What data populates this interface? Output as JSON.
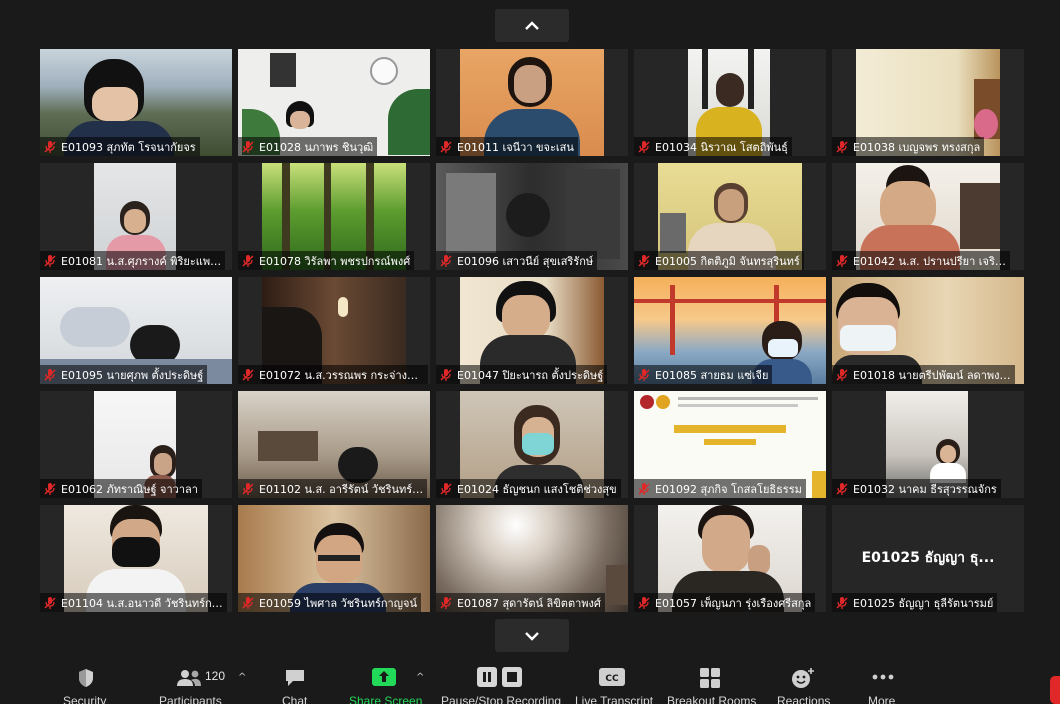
{
  "participants": [
    {
      "name": "E01093 สุภทัต โรจนากัยจร"
    },
    {
      "name": "E01028 นภาพร ชินวุฒิ"
    },
    {
      "name": "E01011 เจนีวา ขจะเสน"
    },
    {
      "name": "E01034 นิรวาณ โสตถิพันธุ์"
    },
    {
      "name": "E01038 เบญจพร ทรงสกุล"
    },
    {
      "name": "E01081 น.ส.ศุภรางค์ พิริยะแพ…"
    },
    {
      "name": "E01078 วิรัลพา พชรปกรณ์พงศ์"
    },
    {
      "name": "E01096 เสาวนีย์ สุขเสริรักษ์"
    },
    {
      "name": "E01005 กิตติภูมิ จันทรสุรินทร์"
    },
    {
      "name": "E01042 น.ส. ปรานปรียา เจริ…"
    },
    {
      "name": "E01095 นายศุภพ ตั้งประดิษฐ์"
    },
    {
      "name": "E01072 น.ส.วรรณพร กระจ่างศ…"
    },
    {
      "name": "E01047 ปิยะนารถ ตั้งประดิษฐ์"
    },
    {
      "name": "E01085 สายธม แซ่เจีย"
    },
    {
      "name": "E01018 นายตรีปพัฒน์ ลดาพง…"
    },
    {
      "name": "E01062 ภัทราณิษฐ์ จาวาลา"
    },
    {
      "name": "E01102 น.ส. อารีรัตน์ วัชรินทร์…"
    },
    {
      "name": "E01024 ธัญชนก แสงโชติช่วงสุข"
    },
    {
      "name": "E01092 สุภกิจ โกสลโยธิธรรม"
    },
    {
      "name": "E01032 นาคม ธีรสุวรรณจักร"
    },
    {
      "name": "E01104 น.ส.อนาวดี วัชรินทร์ก…"
    },
    {
      "name": "E01059 ไพศาล วัชรินทร์กาญจน์"
    },
    {
      "name": "E01087 สุดารัตน์ ลิขิตตาพงศ์"
    },
    {
      "name": "E01057 เพ็ญนภา รุ่งเรืองศรีสกุล"
    },
    {
      "name": "E01025 ธัญญา ธุลีรัตนารมย์",
      "display_name": "E01025 ธัญญา ธุ..."
    }
  ],
  "toolbar": {
    "security": "Security",
    "participants": "Participants",
    "participants_count": "120",
    "chat": "Chat",
    "share_screen": "Share Screen",
    "record": "Pause/Stop Recording",
    "transcript": "Live Transcript",
    "breakout": "Breakout Rooms",
    "reactions": "Reactions",
    "more": "More",
    "cc_text": "CC"
  },
  "colors": {
    "share_green": "#23d959",
    "mic_muted_red": "#e02828",
    "background": "#1a1a1a"
  }
}
